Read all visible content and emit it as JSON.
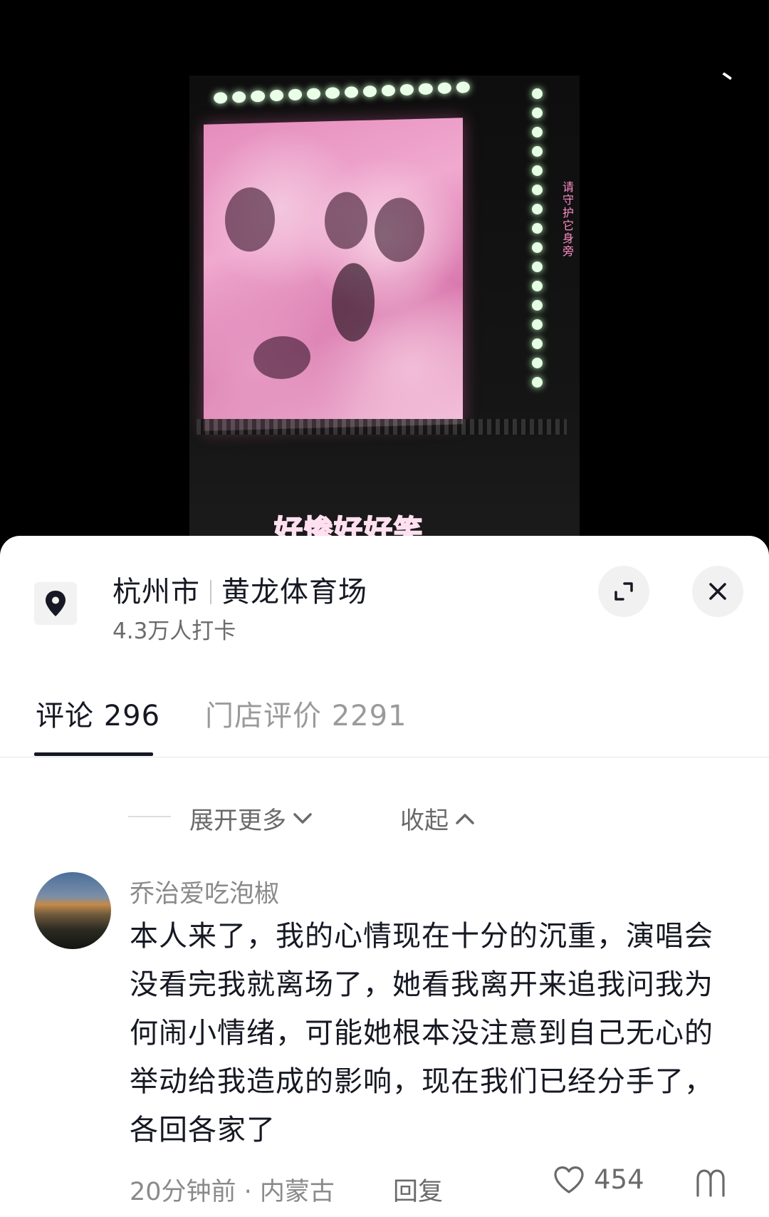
{
  "video": {
    "vertical_caption": "请守护它身旁",
    "subtitle": "好惨好好笑"
  },
  "location": {
    "city": "杭州市",
    "venue": "黄龙体育场",
    "checkins": "4.3万人打卡"
  },
  "tabs": [
    {
      "label": "评论 296"
    },
    {
      "label": "门店评价 2291"
    }
  ],
  "thread": {
    "expand_more": "展开更多",
    "collapse": "收起"
  },
  "comment": {
    "username": "乔治爱吃泡椒",
    "text": "本人来了，我的心情现在十分的沉重，演唱会没看完我就离场了，她看我离开来追我问我为何闹小情绪，可能她根本没注意到自己无心的举动给我造成的影响，现在我们已经分手了，各回各家了",
    "time_location": "20分钟前 · 内蒙古",
    "reply_label": "回复",
    "likes": "454"
  },
  "icons": {
    "location": "map-pin-icon",
    "expand": "expand-icon",
    "close": "close-icon",
    "chevron_down": "chevron-down-icon",
    "chevron_up": "chevron-up-icon",
    "like": "heart-icon",
    "dislike": "dislike-icon"
  }
}
